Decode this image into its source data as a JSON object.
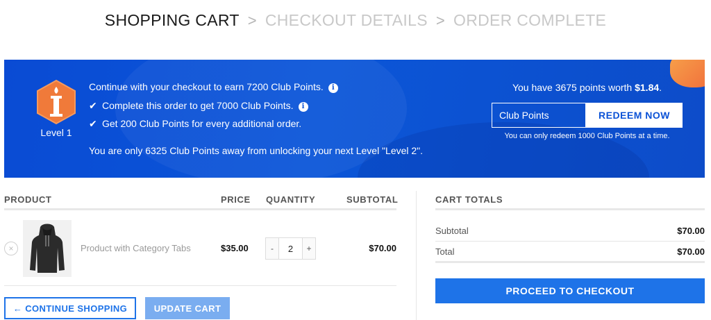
{
  "breadcrumb": {
    "steps": [
      "SHOPPING CART",
      "CHECKOUT DETAILS",
      "ORDER COMPLETE"
    ],
    "separator": ">"
  },
  "banner": {
    "level_icon_text": "1",
    "level_label": "Level 1",
    "line1": "Continue with your checkout to earn 7200 Club Points.",
    "line2": "Complete this order to get 7000 Club Points.",
    "line3": "Get 200 Club Points for every additional order.",
    "line4": "You are only 6325 Club Points away from unlocking your next Level \"Level 2\".",
    "check_glyph": "✔",
    "info_glyph": "i",
    "points_prefix": "You have 3675 points worth",
    "points_value": "$1.84",
    "points_suffix": ".",
    "redeem_input_value": "Club Points",
    "redeem_button": "REDEEM NOW",
    "redeem_note": "You can only redeem 1000 Club Points at a time.",
    "colors": {
      "banner_blue": "#0b52d6",
      "badge_orange": "#f07a3a"
    }
  },
  "table": {
    "headers": {
      "product": "PRODUCT",
      "price": "PRICE",
      "quantity": "QUANTITY",
      "subtotal": "SUBTOTAL"
    },
    "rows": [
      {
        "remove_glyph": "×",
        "name": "Product with Category Tabs",
        "price": "$35.00",
        "qty": "2",
        "subtotal": "$70.00"
      }
    ],
    "qty_minus": "-",
    "qty_plus": "+"
  },
  "actions": {
    "continue_shopping": "← CONTINUE SHOPPING",
    "update_cart": "UPDATE CART"
  },
  "totals": {
    "title": "CART TOTALS",
    "subtotal_label": "Subtotal",
    "subtotal_value": "$70.00",
    "total_label": "Total",
    "total_value": "$70.00",
    "checkout_button": "PROCEED TO CHECKOUT"
  }
}
